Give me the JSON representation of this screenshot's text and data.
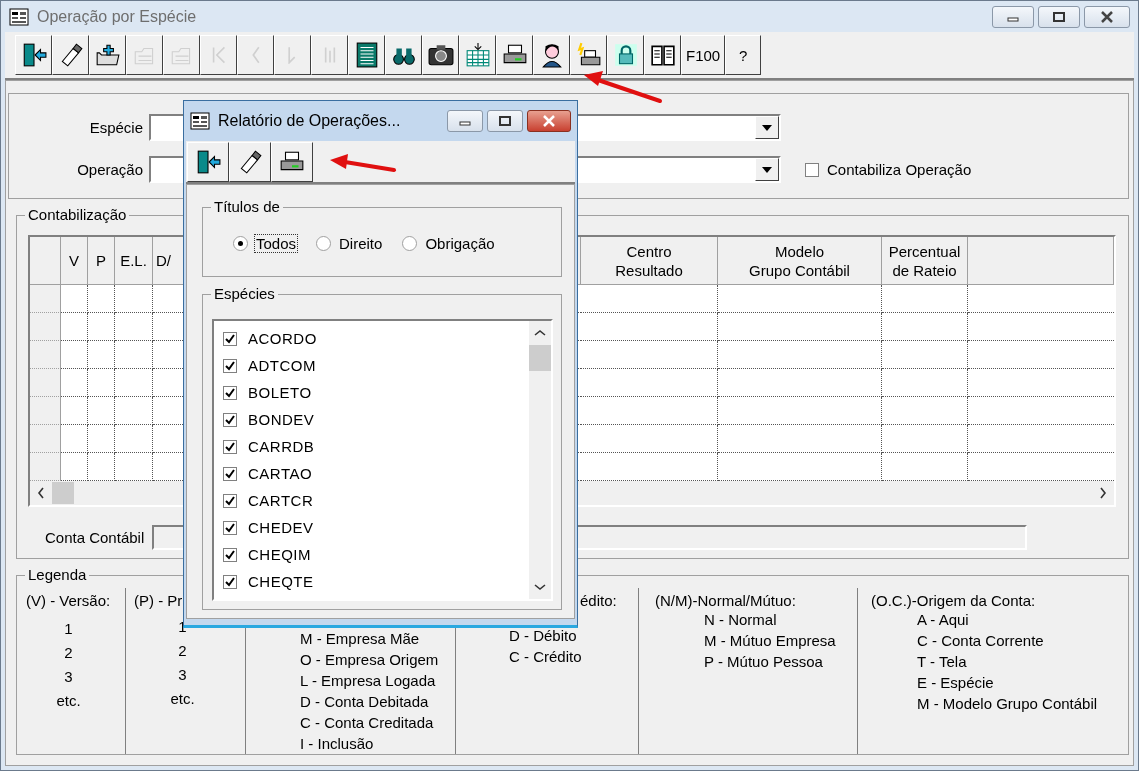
{
  "window": {
    "title": "Operação por Espécie",
    "active": false
  },
  "toolbar": [
    {
      "kind": "exit",
      "disabled": false
    },
    {
      "kind": "eraser",
      "disabled": false
    },
    {
      "kind": "folder-add",
      "disabled": false
    },
    {
      "kind": "folder-stack",
      "disabled": true
    },
    {
      "kind": "form-stack",
      "disabled": true
    },
    {
      "kind": "first",
      "disabled": true
    },
    {
      "kind": "prev",
      "disabled": true
    },
    {
      "kind": "next",
      "disabled": true
    },
    {
      "kind": "last",
      "disabled": true
    },
    {
      "kind": "list",
      "disabled": false
    },
    {
      "kind": "binoculars",
      "disabled": false
    },
    {
      "kind": "camera",
      "disabled": false
    },
    {
      "kind": "table",
      "disabled": false
    },
    {
      "kind": "printer",
      "disabled": false
    },
    {
      "kind": "person",
      "disabled": false
    },
    {
      "kind": "printer-flash",
      "disabled": false
    },
    {
      "kind": "lock",
      "disabled": false
    },
    {
      "kind": "book",
      "disabled": false
    },
    {
      "kind": "text",
      "label": "F100",
      "disabled": false
    },
    {
      "kind": "text",
      "label": "?",
      "disabled": false
    }
  ],
  "form": {
    "especie": {
      "label": "Espécie"
    },
    "operacao": {
      "label": "Operação"
    },
    "contabiliza": {
      "label": "Contabiliza Operação",
      "checked": false
    }
  },
  "contabilizacao": {
    "title": "Contabilização",
    "columns": [
      {
        "label": "V"
      },
      {
        "label": "P"
      },
      {
        "label": "E.L."
      },
      {
        "label": "D/"
      },
      {
        "label": "Centro\nResultado"
      },
      {
        "label": "Modelo\nGrupo Contábil"
      },
      {
        "label": "Percentual\nde Rateio"
      }
    ],
    "conta_contabil": {
      "label": "Conta Contábil"
    }
  },
  "legend": {
    "title": "Legenda",
    "columns": [
      {
        "heading": "(V) - Versão:",
        "items": [
          "1",
          "2",
          "3",
          "etc."
        ]
      },
      {
        "heading": "(P) - Pr",
        "items": [
          "1",
          "2",
          "3",
          "etc."
        ]
      },
      {
        "items": [
          "M - Empresa Mãe",
          "O - Empresa Origem",
          "L - Empresa Logada",
          "D - Conta Debitada",
          "C - Conta Creditada",
          "I - Inclusão"
        ]
      },
      {
        "heading": "édito:",
        "items": [
          "D - Débito",
          "C - Crédito"
        ]
      },
      {
        "heading": "(N/M)-Normal/Mútuo:",
        "items": [
          "N - Normal",
          "M - Mútuo Empresa",
          "P - Mútuo Pessoa"
        ]
      },
      {
        "heading": "(O.C.)-Origem da Conta:",
        "items": [
          "A - Aqui",
          "C - Conta Corrente",
          "T - Tela",
          "E - Espécie",
          "M - Modelo Grupo Contábil"
        ]
      }
    ]
  },
  "dialog": {
    "title": "Relatório de Operações...",
    "active": true,
    "toolbar": [
      {
        "kind": "exit"
      },
      {
        "kind": "eraser"
      },
      {
        "kind": "printer"
      }
    ],
    "titulos": {
      "title": "Títulos de",
      "options": [
        {
          "label": "Todos",
          "selected": true
        },
        {
          "label": "Direito",
          "selected": false
        },
        {
          "label": "Obrigação",
          "selected": false
        }
      ]
    },
    "especies": {
      "title": "Espécies",
      "items": [
        {
          "label": "ACORDO",
          "checked": true
        },
        {
          "label": "ADTCOM",
          "checked": true
        },
        {
          "label": "BOLETO",
          "checked": true
        },
        {
          "label": "BONDEV",
          "checked": true
        },
        {
          "label": "CARRDB",
          "checked": true
        },
        {
          "label": "CARTAO",
          "checked": true
        },
        {
          "label": "CARTCR",
          "checked": true
        },
        {
          "label": "CHEDEV",
          "checked": true
        },
        {
          "label": "CHEQIM",
          "checked": true
        },
        {
          "label": "CHEQTE",
          "checked": true
        }
      ]
    }
  }
}
